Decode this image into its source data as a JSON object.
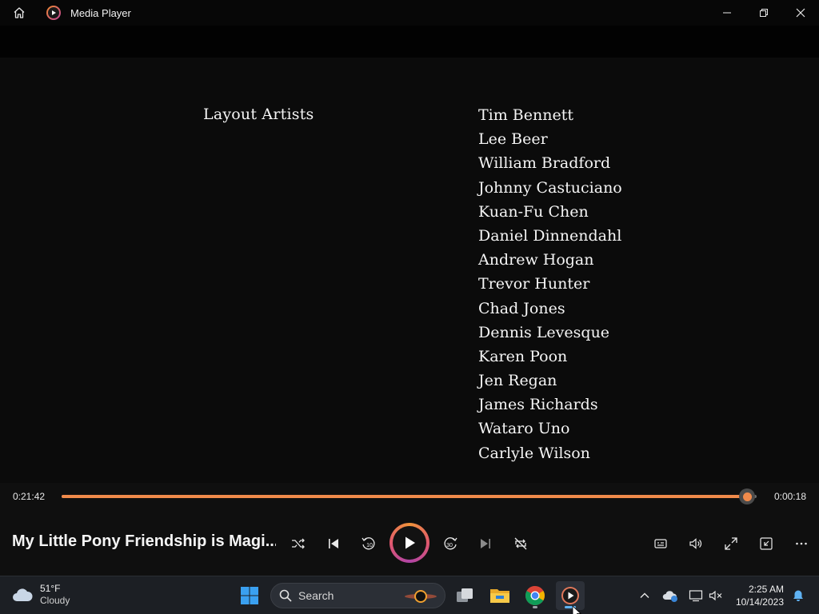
{
  "window": {
    "title": "Media Player",
    "icons": {
      "home": "home-icon",
      "app": "media-player-icon",
      "minimize": "minimize-icon",
      "restore": "restore-icon",
      "close": "close-icon"
    }
  },
  "credits": {
    "role": "Layout Artists",
    "names": [
      "Tim Bennett",
      "Lee Beer",
      "William Bradford",
      "Johnny Castuciano",
      "Kuan-Fu Chen",
      "Daniel Dinnendahl",
      "Andrew Hogan",
      "Trevor Hunter",
      "Chad Jones",
      "Dennis Levesque",
      "Karen Poon",
      "Jen Regan",
      "James Richards",
      "Wataro Uno",
      "Carlyle Wilson"
    ]
  },
  "playback": {
    "elapsed": "0:21:42",
    "remaining": "0:00:18",
    "progress": 0.9862,
    "accent_color": "#f08a4b"
  },
  "now_playing": {
    "title": "My Little Pony Friendship is Magi..."
  },
  "controls": {
    "skip_back_seconds": "10",
    "skip_forward_seconds": "30",
    "icons": [
      "shuffle-icon",
      "previous-icon",
      "skip-back-icon",
      "play-icon",
      "skip-forward-icon",
      "next-icon",
      "repeat-off-icon",
      "subtitles-icon",
      "volume-icon",
      "fullscreen-icon",
      "mini-player-icon",
      "more-icon"
    ]
  },
  "taskbar": {
    "weather": {
      "temp": "51°F",
      "condition": "Cloudy"
    },
    "search_label": "Search",
    "clock": {
      "time": "2:25 AM",
      "date": "10/14/2023"
    },
    "apps": [
      "start-icon",
      "search-icon",
      "task-view-icon",
      "file-explorer-icon",
      "chrome-icon",
      "media-player-icon"
    ],
    "tray": [
      "chevron-up-icon",
      "onedrive-icon",
      "network-icon",
      "volume-muted-icon",
      "notification-bell-icon"
    ]
  }
}
